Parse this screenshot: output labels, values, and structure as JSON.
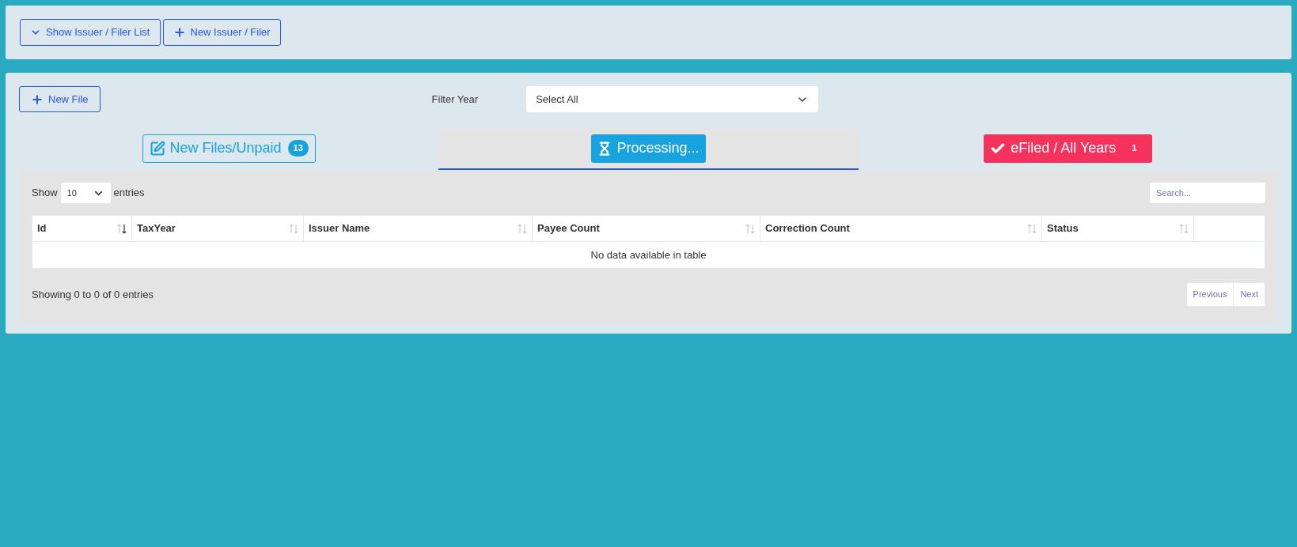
{
  "top_bar": {
    "buttons": [
      {
        "label": "Show Issuer / Filer List"
      },
      {
        "label": "New Issuer / Filer"
      }
    ]
  },
  "files": {
    "new_button": "New File",
    "filter": {
      "label": "Filter Year",
      "value": "Select All"
    },
    "tabs": [
      {
        "label": "New Files/Unpaid",
        "badge": "13",
        "kind": "outline",
        "color": "#17a2e0",
        "selected": false
      },
      {
        "label": "Processing...",
        "kind": "solid",
        "color": "#17a2e0",
        "selected": true
      },
      {
        "label": "eFiled / All Years",
        "badge": "1",
        "kind": "solid",
        "color": "#f5325c",
        "selected": false
      }
    ],
    "table": {
      "show_label": "Show",
      "page_size": "10",
      "entries_label": "entries",
      "search_placeholder": "Search...",
      "columns": [
        {
          "label": "Id",
          "sorted": true
        },
        {
          "label": "TaxYear",
          "sorted": false
        },
        {
          "label": "Issuer Name",
          "sorted": false
        },
        {
          "label": "Payee Count",
          "sorted": false
        },
        {
          "label": "Correction Count",
          "sorted": false
        },
        {
          "label": "Status",
          "sorted": false
        }
      ],
      "empty_message": "No data available in table",
      "info": "Showing 0 to 0 of 0 entries",
      "pager": [
        "Previous",
        "Next"
      ]
    }
  }
}
